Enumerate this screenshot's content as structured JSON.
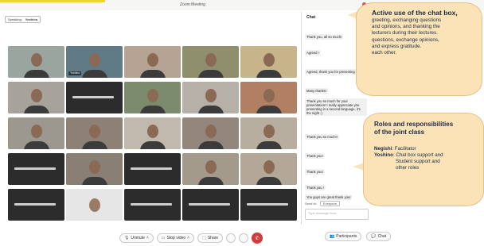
{
  "window": {
    "title": "Zoom Meeting"
  },
  "speaker": {
    "label": "Speaking:",
    "name": "Yoshino"
  },
  "participants": [
    {
      "name": "",
      "bg": "#9aa5a0",
      "dark": false
    },
    {
      "name": "Yoshino",
      "bg": "#607a86",
      "dark": false
    },
    {
      "name": "",
      "bg": "#b5a394",
      "dark": false
    },
    {
      "name": "",
      "bg": "#8f8f6e",
      "dark": false
    },
    {
      "name": "",
      "bg": "#c7b48a",
      "dark": false
    },
    {
      "name": "",
      "bg": "#a8a29c",
      "dark": false
    },
    {
      "name": "",
      "bg": "#2c2c2c",
      "dark": true
    },
    {
      "name": "",
      "bg": "#7c8a6d",
      "dark": false
    },
    {
      "name": "",
      "bg": "#b6b0a8",
      "dark": false
    },
    {
      "name": "",
      "bg": "#b18063",
      "dark": false
    },
    {
      "name": "",
      "bg": "#9c9890",
      "dark": false
    },
    {
      "name": "",
      "bg": "#8d8075",
      "dark": false
    },
    {
      "name": "",
      "bg": "#c2b9ae",
      "dark": false
    },
    {
      "name": "",
      "bg": "#93877d",
      "dark": false
    },
    {
      "name": "",
      "bg": "#b8ae9f",
      "dark": false
    },
    {
      "name": "",
      "bg": "#2c2c2c",
      "dark": true
    },
    {
      "name": "",
      "bg": "#8a7f74",
      "dark": false
    },
    {
      "name": "",
      "bg": "#2c2c2c",
      "dark": true
    },
    {
      "name": "",
      "bg": "#a49a8c",
      "dark": false
    },
    {
      "name": "",
      "bg": "#b3a898",
      "dark": false
    },
    {
      "name": "",
      "bg": "#2c2c2c",
      "dark": true
    },
    {
      "name": "",
      "bg": "#e6e6e6",
      "dark": false
    },
    {
      "name": "",
      "bg": "#2c2c2c",
      "dark": true
    },
    {
      "name": "",
      "bg": "#2c2c2c",
      "dark": true
    },
    {
      "name": "",
      "bg": "#2c2c2c",
      "dark": true
    }
  ],
  "chat": {
    "title": "Chat",
    "messages": [
      {
        "text": "Thank you, all so much!"
      },
      {
        "text": "Agreed !"
      },
      {
        "text": "Agreed, thank you for presenting"
      },
      {
        "text": "Many thanks!"
      },
      {
        "text": "Thank you so much for your presentation! I really appreciate you presenting in a second language, it's the night :)"
      },
      {
        "text": "Thank you so much!!"
      },
      {
        "text": "Thank you!"
      },
      {
        "text": "Thank you!"
      },
      {
        "text": "Thank you !"
      },
      {
        "text": "You guys are great thank you!"
      }
    ],
    "send_to_label": "Send to:",
    "send_to_value": "Everyone",
    "input_placeholder": "Type message here..."
  },
  "toolbar": {
    "unmute": "Unmute",
    "stop_video": "Stop video",
    "share": "Share",
    "participants": "Participants",
    "chat": "Chat"
  },
  "callout_a": {
    "heading": "Active use of the chat box,",
    "body_lines": [
      "greeting, exchanging questions",
      "and opinions, and thanking the",
      "lecturers during their lectures.",
      "questions, exchange opinions,",
      "and express gratitude.",
      "each other."
    ]
  },
  "callout_b": {
    "heading_line1": "Roles and responsibilities",
    "heading_line2": "of the joint class",
    "negishi_name": "Negishi",
    "negishi_role": ": Facilitator",
    "yoshino_name": "Yoshino",
    "yoshino_role": ": Chat box support and",
    "yoshino_role_2": "Student support    and",
    "yoshino_role_3": "other roles"
  }
}
